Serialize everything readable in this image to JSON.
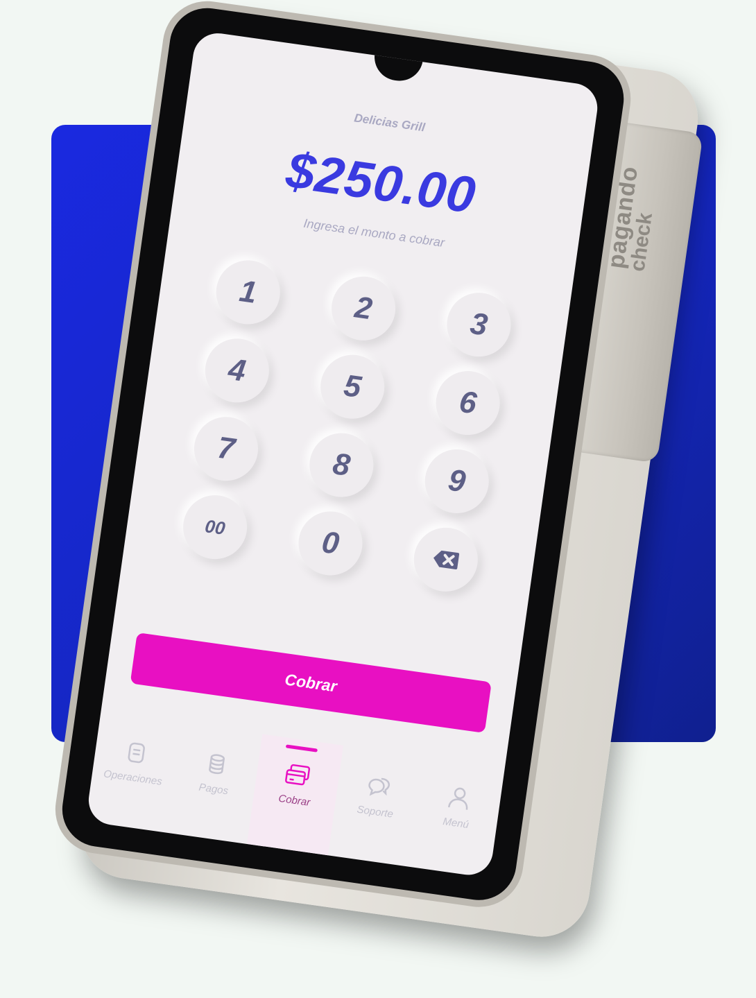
{
  "device": {
    "brand_line1": "pagando",
    "brand_line2": "check"
  },
  "screen": {
    "merchant_name": "Delicias Grill",
    "amount": "$250.00",
    "amount_hint": "Ingresa el monto a cobrar"
  },
  "keypad": {
    "keys": [
      "1",
      "2",
      "3",
      "4",
      "5",
      "6",
      "7",
      "8",
      "9",
      "00",
      "0"
    ],
    "backspace_icon": "backspace-icon"
  },
  "actions": {
    "charge_label": "Cobrar"
  },
  "tabbar": {
    "items": [
      {
        "label": "Operaciones",
        "icon": "operations-icon"
      },
      {
        "label": "Pagos",
        "icon": "coins-icon"
      },
      {
        "label": "Cobrar",
        "icon": "cards-icon",
        "active": true
      },
      {
        "label": "Soporte",
        "icon": "chat-icon"
      },
      {
        "label": "Menú",
        "icon": "user-icon"
      }
    ]
  },
  "colors": {
    "accent": "#e810c2",
    "amount": "#3a3ae0",
    "backdrop": "#1527c4"
  }
}
